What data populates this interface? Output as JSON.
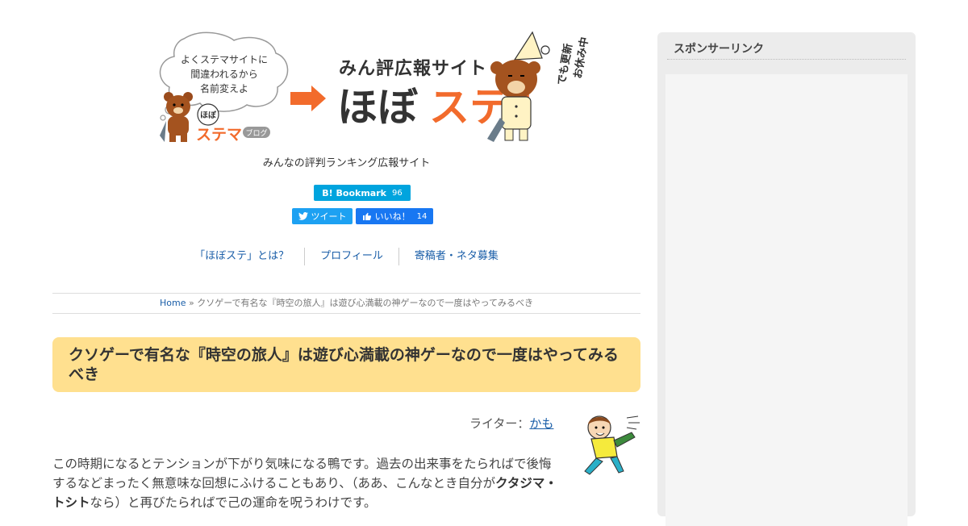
{
  "banner": {
    "bubble_lines": [
      "よくステマサイトに",
      "間違われるから",
      "名前変えよ"
    ],
    "old_logo_small": "ほぼ",
    "old_logo_main": "ステマ",
    "old_logo_tag": "ブログ",
    "site_subtitle": "みん評広報サイト",
    "site_logo_a": "ほぼ",
    "site_logo_b": "ステ",
    "site_logo_c": "!",
    "side_note_1": "でも更新",
    "side_note_2": "お休み中"
  },
  "tagline": "みんなの評判ランキング広報サイト",
  "share": {
    "hatena_label": "B! Bookmark",
    "hatena_count": "96",
    "tweet_label": "ツイート",
    "fb_label": "いいね！",
    "fb_count": "14"
  },
  "nav": [
    "「ほぼステ」とは？",
    "プロフィール",
    "寄稿者・ネタ募集"
  ],
  "breadcrumb": {
    "home": "Home",
    "sep": " » ",
    "current": "クソゲーで有名な『時空の旅人』は遊び心満載の神ゲーなので一度はやってみるべき"
  },
  "article": {
    "title": "クソゲーで有名な『時空の旅人』は遊び心満載の神ゲーなので一度はやってみるべき",
    "writer_label": "ライター：",
    "writer_name": "かも",
    "body_1": "この時期になるとテンションが下がり気味になる鴨です。過去の出来事をたられば",
    "body_2": "で後悔するなどまったく無意味な回想にふけることもあり、（ああ、こんなとき自分が",
    "body_bold": "クタジマ・トシト",
    "body_3": "なら）と再びたられば",
    "body_4": "で己の運命を呪うわけです。"
  },
  "sidebar": {
    "heading": "スポンサーリンク"
  },
  "colors": {
    "accent_orange": "#f26b2c",
    "title_bg": "#ffe08f",
    "link": "#1a5ea8",
    "hatena": "#00a4de",
    "twitter": "#1da1f2",
    "facebook": "#1877f2"
  },
  "icons": {
    "twitter": "twitter-bird-icon",
    "facebook": "facebook-thumb-icon",
    "arrow": "arrow-right-icon"
  }
}
